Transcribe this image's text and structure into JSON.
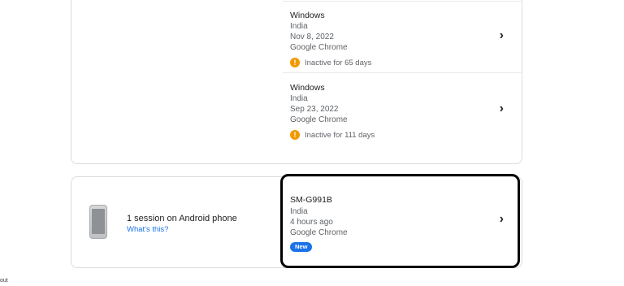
{
  "devices": [
    {
      "name": "Windows",
      "location": "India",
      "date": "Nov 8, 2022",
      "browser": "Google Chrome",
      "status": "Inactive for 65 days"
    },
    {
      "name": "Windows",
      "location": "India",
      "date": "Sep 23, 2022",
      "browser": "Google Chrome",
      "status": "Inactive for 111 days"
    }
  ],
  "android": {
    "session_title": "1 session on Android phone",
    "link": "What's this?",
    "device": {
      "name": "SM-G991B",
      "location": "India",
      "time": "4 hours ago",
      "browser": "Google Chrome",
      "badge": "New"
    }
  },
  "footer_fragment": "out",
  "icons": {
    "chevron": "chevron-right-icon",
    "warning": "warning-icon",
    "phone": "phone-icon"
  },
  "colors": {
    "warning": "#f29900",
    "badge": "#1a73e8",
    "link": "#1a73e8"
  }
}
